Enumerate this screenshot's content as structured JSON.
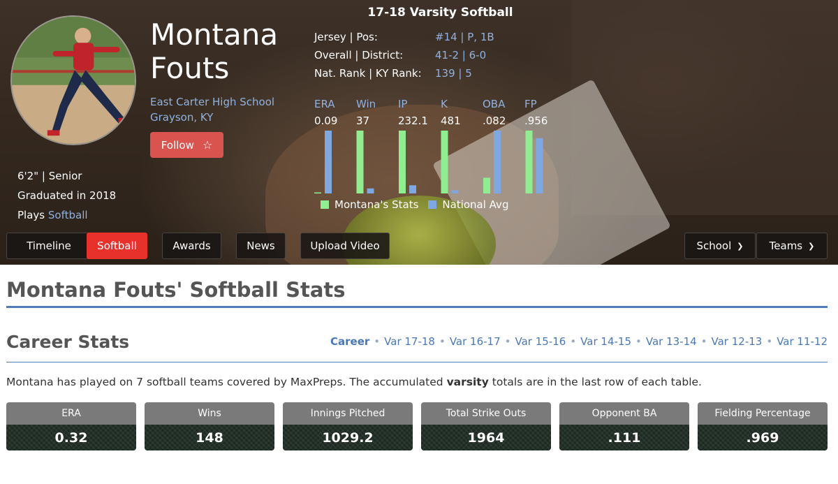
{
  "profile": {
    "name_line1": "Montana",
    "name_line2": "Fouts",
    "school": "East Carter High School",
    "location": "Grayson, KY",
    "follow_label": "Follow",
    "height_class": "6'2\" | Senior",
    "graduated": "Graduated in 2018",
    "plays_prefix": "Plays",
    "sport": "Softball"
  },
  "season": {
    "title": "17-18 Varsity Softball",
    "info": [
      {
        "label": "Jersey | Pos:",
        "value": "#14 | P, 1B"
      },
      {
        "label": "Overall | District:",
        "value": "41-2 | 6-0"
      },
      {
        "label": "Nat. Rank | KY Rank:",
        "value": "139 | 5"
      }
    ],
    "stats": [
      {
        "label": "ERA",
        "value": "0.09"
      },
      {
        "label": "Win",
        "value": "37"
      },
      {
        "label": "IP",
        "value": "232.1"
      },
      {
        "label": "K",
        "value": "481"
      },
      {
        "label": "OBA",
        "value": ".082"
      },
      {
        "label": "FP",
        "value": ".956"
      }
    ]
  },
  "chart_data": {
    "type": "bar",
    "categories": [
      "ERA",
      "Win",
      "IP",
      "K",
      "OBA",
      "FP"
    ],
    "series": [
      {
        "name": "Montana's Stats",
        "color": "#90ee90",
        "values": [
          0.01,
          1.0,
          1.0,
          1.0,
          0.25,
          1.0
        ]
      },
      {
        "name": "National Avg",
        "color": "#7fa8e0",
        "values": [
          1.0,
          0.08,
          0.13,
          0.05,
          1.0,
          0.88
        ]
      }
    ],
    "ylim": [
      0,
      1
    ]
  },
  "nav": {
    "tabs": [
      {
        "label": "Timeline",
        "active": false
      },
      {
        "label": "Softball",
        "active": true
      },
      {
        "label": "Awards",
        "active": false
      },
      {
        "label": "News",
        "active": false
      },
      {
        "label": "Upload Video",
        "active": false
      }
    ],
    "dropdowns": [
      {
        "label": "School",
        "icon": "chevron-down-icon"
      },
      {
        "label": "Teams",
        "icon": "chevron-down-icon"
      }
    ]
  },
  "main": {
    "heading": "Montana Fouts' Softball Stats",
    "career_title": "Career Stats",
    "season_links": [
      "Career",
      "Var 17-18",
      "Var 16-17",
      "Var 15-16",
      "Var 14-15",
      "Var 13-14",
      "Var 12-13",
      "Var 11-12"
    ],
    "intro_before": "Montana has played on 7 softball teams covered by MaxPreps. The accumulated ",
    "intro_bold": "varsity",
    "intro_after": " totals are in the last row of each table.",
    "career_cards": [
      {
        "label": "ERA",
        "value": "0.32"
      },
      {
        "label": "Wins",
        "value": "148"
      },
      {
        "label": "Innings Pitched",
        "value": "1029.2"
      },
      {
        "label": "Total Strike Outs",
        "value": "1964"
      },
      {
        "label": "Opponent BA",
        "value": ".111"
      },
      {
        "label": "Fielding Percentage",
        "value": ".969"
      }
    ]
  },
  "colors": {
    "accent_red": "#e8312b",
    "follow_red": "#d9534f",
    "link_blue": "#4a78b4",
    "light_blue": "#8fb2e0",
    "bar_green": "#90ee90",
    "bar_blue": "#7fa8e0"
  }
}
